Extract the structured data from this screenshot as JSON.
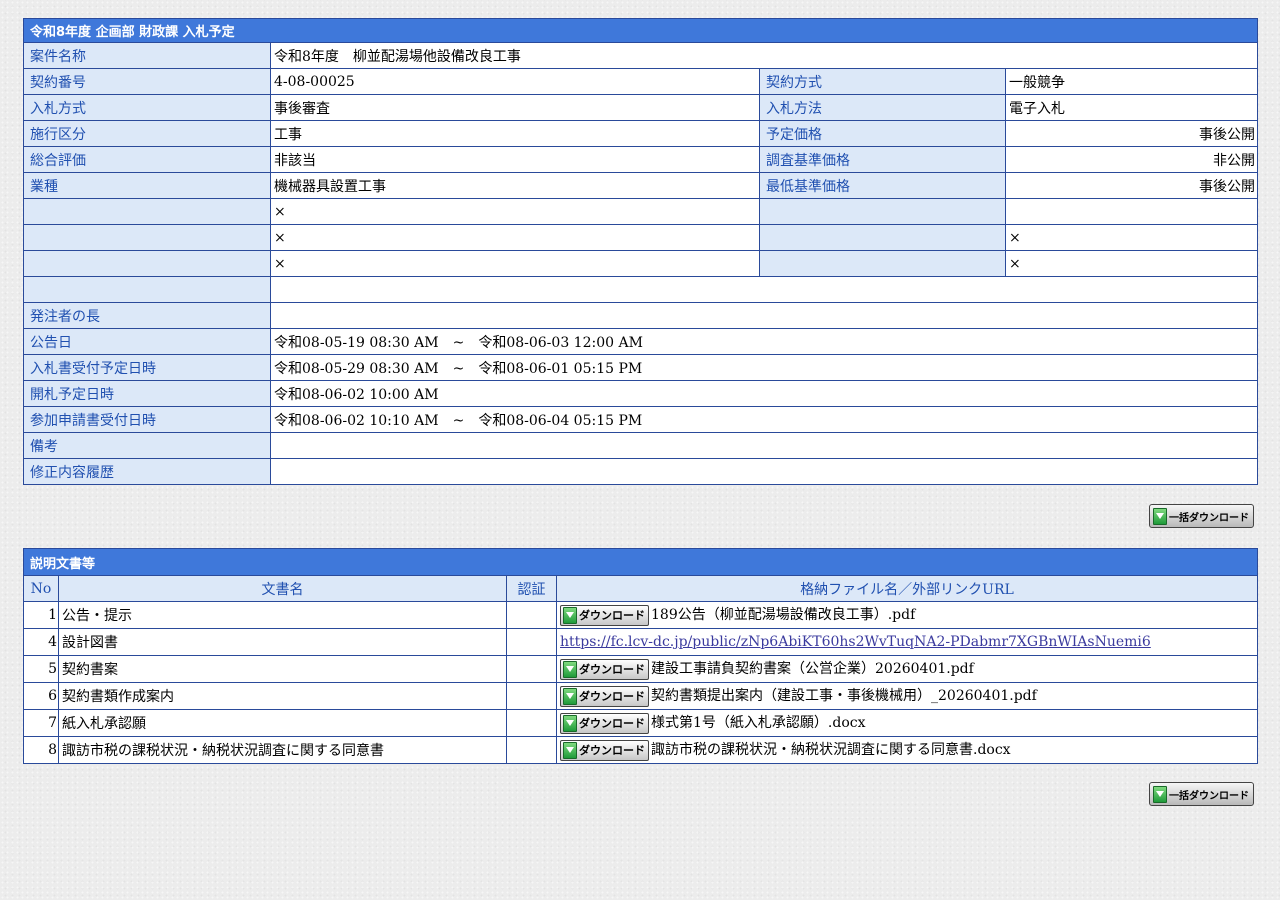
{
  "info": {
    "caption": "令和8年度 企画部 財政課 入札予定",
    "project_name_label": "案件名称",
    "project_name_value": "令和8年度　柳並配湯場他設備改良工事",
    "rows": [
      {
        "l1": "契約番号",
        "v1": "4-08-00025",
        "l2": "契約方式",
        "v2": "一般競争"
      },
      {
        "l1": "入札方式",
        "v1": "事後審査",
        "l2": "入札方法",
        "v2": "電子入札"
      },
      {
        "l1": "施行区分",
        "v1": "工事",
        "l2": "予定価格",
        "v2": "事後公開"
      },
      {
        "l1": "総合評価",
        "v1": "非該当",
        "l2": "調査基準価格",
        "v2": "非公開"
      },
      {
        "l1": "業種",
        "v1": "機械器具設置工事",
        "l2": "最低基準価格",
        "v2": "事後公開"
      },
      {
        "l1": "",
        "v1": "×",
        "l2": "",
        "v2": ""
      },
      {
        "l1": "",
        "v1": "×",
        "l2": "",
        "v2": "×"
      },
      {
        "l1": "",
        "v1": "×",
        "l2": "",
        "v2": "×"
      }
    ],
    "wide_rows": [
      {
        "l": "",
        "v": ""
      },
      {
        "l": "発注者の長",
        "v": ""
      },
      {
        "l": "公告日",
        "v": "令和08-05-19 08:30 AM　~　令和08-06-03 12:00 AM"
      },
      {
        "l": "入札書受付予定日時",
        "v": "令和08-05-29 08:30 AM　~　令和08-06-01 05:15 PM"
      },
      {
        "l": "開札予定日時",
        "v": "令和08-06-02 10:00 AM"
      },
      {
        "l": "参加申請書受付日時",
        "v": "令和08-06-02 10:10 AM　~　令和08-06-04 05:15 PM"
      },
      {
        "l": "備考",
        "v": ""
      },
      {
        "l": "修正内容履歴",
        "v": ""
      }
    ]
  },
  "bulk_download_label": "一括ダウンロード",
  "download_button_label": "ダウンロード",
  "docs": {
    "caption": "説明文書等",
    "headers": {
      "no": "No",
      "name": "文書名",
      "auth": "認証",
      "file": "格納ファイル名／外部リンクURL"
    },
    "rows": [
      {
        "no": "1",
        "name": "公告・提示",
        "auth": "",
        "file": "189公告（柳並配湯場設備改良工事）.pdf",
        "kind": "file"
      },
      {
        "no": "4",
        "name": "設計図書",
        "auth": "",
        "file": "https://fc.lcv-dc.jp/public/zNp6AbiKT60hs2WvTuqNA2-PDabmr7XGBnWIAsNuemi6",
        "kind": "link"
      },
      {
        "no": "5",
        "name": "契約書案",
        "auth": "",
        "file": "建設工事請負契約書案（公営企業）20260401.pdf",
        "kind": "file"
      },
      {
        "no": "6",
        "name": "契約書類作成案内",
        "auth": "",
        "file": "契約書類提出案内（建設工事・事後機械用）_20260401.pdf",
        "kind": "file"
      },
      {
        "no": "7",
        "name": "紙入札承認願",
        "auth": "",
        "file": "様式第1号（紙入札承認願）.docx",
        "kind": "file"
      },
      {
        "no": "8",
        "name": "諏訪市税の課税状況・納税状況調査に関する同意書",
        "auth": "",
        "file": "諏訪市税の課税状況・納税状況調査に関する同意書.docx",
        "kind": "file"
      }
    ]
  }
}
